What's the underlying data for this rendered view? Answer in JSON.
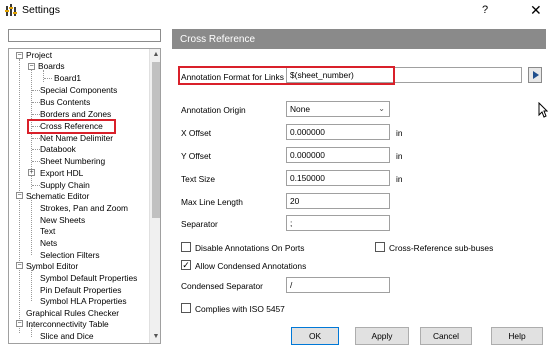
{
  "window": {
    "title": "Settings",
    "help_label": "?",
    "close_label": "✕"
  },
  "tree": {
    "items": [
      {
        "label": "Project"
      },
      {
        "label": "Boards"
      },
      {
        "label": "Board1"
      },
      {
        "label": "Special Components"
      },
      {
        "label": "Bus Contents"
      },
      {
        "label": "Borders and Zones"
      },
      {
        "label": "Cross Reference"
      },
      {
        "label": "Net Name Delimiter"
      },
      {
        "label": "Databook"
      },
      {
        "label": "Sheet Numbering"
      },
      {
        "label": "Export HDL"
      },
      {
        "label": "Supply Chain"
      },
      {
        "label": "Schematic Editor"
      },
      {
        "label": "Strokes, Pan and Zoom"
      },
      {
        "label": "New Sheets"
      },
      {
        "label": "Text"
      },
      {
        "label": "Nets"
      },
      {
        "label": "Selection Filters"
      },
      {
        "label": "Symbol Editor"
      },
      {
        "label": "Symbol Default Properties"
      },
      {
        "label": "Pin Default Properties"
      },
      {
        "label": "Symbol HLA Properties"
      },
      {
        "label": "Graphical Rules Checker"
      },
      {
        "label": "Interconnectivity Table"
      },
      {
        "label": "Slice and Dice"
      }
    ],
    "expanders": {
      "collapsed": "+",
      "expanded": "−"
    }
  },
  "panel": {
    "header": "Cross Reference",
    "annotation_format_label": "Annotation Format for Links",
    "annotation_format_value": "$(sheet_number)",
    "annotation_origin_label": "Annotation Origin",
    "annotation_origin_value": "None",
    "x_offset_label": "X Offset",
    "x_offset_value": "0.000000",
    "y_offset_label": "Y Offset",
    "y_offset_value": "0.000000",
    "text_size_label": "Text Size",
    "text_size_value": "0.150000",
    "unit": "in",
    "max_line_length_label": "Max Line Length",
    "max_line_length_value": "20",
    "separator_label": "Separator",
    "separator_value": ";",
    "disable_annotations_label": "Disable Annotations On Ports",
    "disable_annotations_checked": false,
    "cross_ref_subbuses_label": "Cross-Reference sub-buses",
    "cross_ref_subbuses_checked": false,
    "allow_condensed_label": "Allow Condensed Annotations",
    "allow_condensed_checked": true,
    "condensed_separator_label": "Condensed Separator",
    "condensed_separator_value": "/",
    "iso_label": "Complies with ISO 5457",
    "iso_checked": false,
    "check_mark": "✓"
  },
  "buttons": {
    "ok": "OK",
    "apply": "Apply",
    "cancel": "Cancel",
    "help": "Help"
  },
  "colors": {
    "highlight": "#d9202a",
    "header_bg": "#8a8a8a",
    "default_button_border": "#0078d7"
  }
}
